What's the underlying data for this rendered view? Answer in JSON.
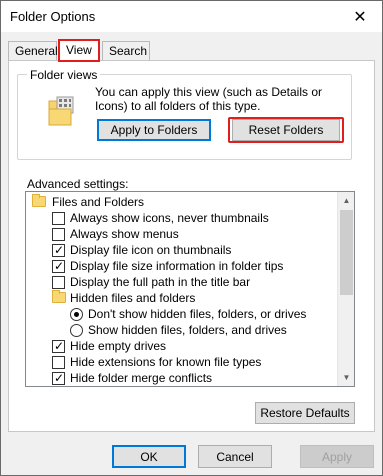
{
  "window": {
    "title": "Folder Options"
  },
  "tabs": [
    {
      "label": "General"
    },
    {
      "label": "View"
    },
    {
      "label": "Search"
    }
  ],
  "folder_views": {
    "label": "Folder views",
    "description": "You can apply this view (such as Details or Icons) to all folders of this type.",
    "apply_label": "Apply to Folders",
    "reset_label": "Reset Folders"
  },
  "advanced": {
    "label": "Advanced settings:",
    "items": [
      {
        "kind": "folder",
        "label": "Files and Folders"
      },
      {
        "kind": "checkbox",
        "checked": false,
        "label": "Always show icons, never thumbnails"
      },
      {
        "kind": "checkbox",
        "checked": false,
        "label": "Always show menus"
      },
      {
        "kind": "checkbox",
        "checked": true,
        "label": "Display file icon on thumbnails"
      },
      {
        "kind": "checkbox",
        "checked": true,
        "label": "Display file size information in folder tips"
      },
      {
        "kind": "checkbox",
        "checked": false,
        "label": "Display the full path in the title bar"
      },
      {
        "kind": "folder",
        "label": "Hidden files and folders"
      },
      {
        "kind": "radio",
        "checked": true,
        "label": "Don't show hidden files, folders, or drives"
      },
      {
        "kind": "radio",
        "checked": false,
        "label": "Show hidden files, folders, and drives"
      },
      {
        "kind": "checkbox",
        "checked": true,
        "label": "Hide empty drives"
      },
      {
        "kind": "checkbox",
        "checked": false,
        "label": "Hide extensions for known file types"
      },
      {
        "kind": "checkbox",
        "checked": true,
        "label": "Hide folder merge conflicts"
      }
    ]
  },
  "restore_label": "Restore Defaults",
  "footer": {
    "ok": "OK",
    "cancel": "Cancel",
    "apply": "Apply"
  },
  "colors": {
    "highlight_red": "#e01e1e",
    "focus_blue": "#0078d7",
    "folder_yellow": "#f8d775"
  },
  "icons": {
    "close": "close-icon",
    "folder": "folder-icon",
    "folder_view": "folder-view-icon"
  }
}
